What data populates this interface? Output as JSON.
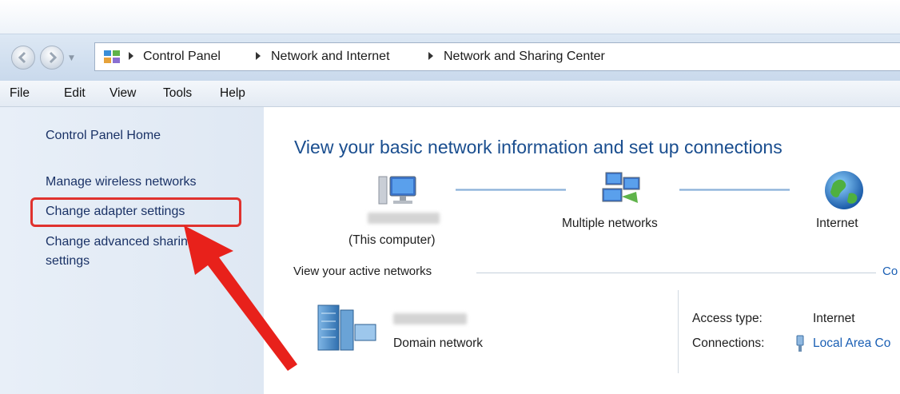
{
  "breadcrumb": {
    "items": [
      "Control Panel",
      "Network and Internet",
      "Network and Sharing Center"
    ]
  },
  "menu": {
    "items": [
      "File",
      "Edit",
      "View",
      "Tools",
      "Help"
    ]
  },
  "sidebar": {
    "items": [
      {
        "label": "Control Panel Home"
      },
      {
        "label": "Manage wireless networks"
      },
      {
        "label": "Change adapter settings"
      },
      {
        "label": "Change advanced sharing",
        "label2": "settings"
      }
    ]
  },
  "main": {
    "heading": "View your basic network information and set up connections",
    "network_map": {
      "this_computer": "(This computer)",
      "middle": "Multiple networks",
      "internet": "Internet"
    },
    "active_networks_label": "View your active networks",
    "active_networks_right": "Co",
    "network": {
      "type": "Domain network",
      "access_type_label": "Access type:",
      "access_type_value": "Internet",
      "connections_label": "Connections:",
      "connections_value": "Local Area Co"
    }
  },
  "icons": {
    "arrow_color": "#e8211b",
    "highlight_color": "#e0322e",
    "heading_color": "#1a4e8f",
    "link_color": "#1a5fb4"
  }
}
